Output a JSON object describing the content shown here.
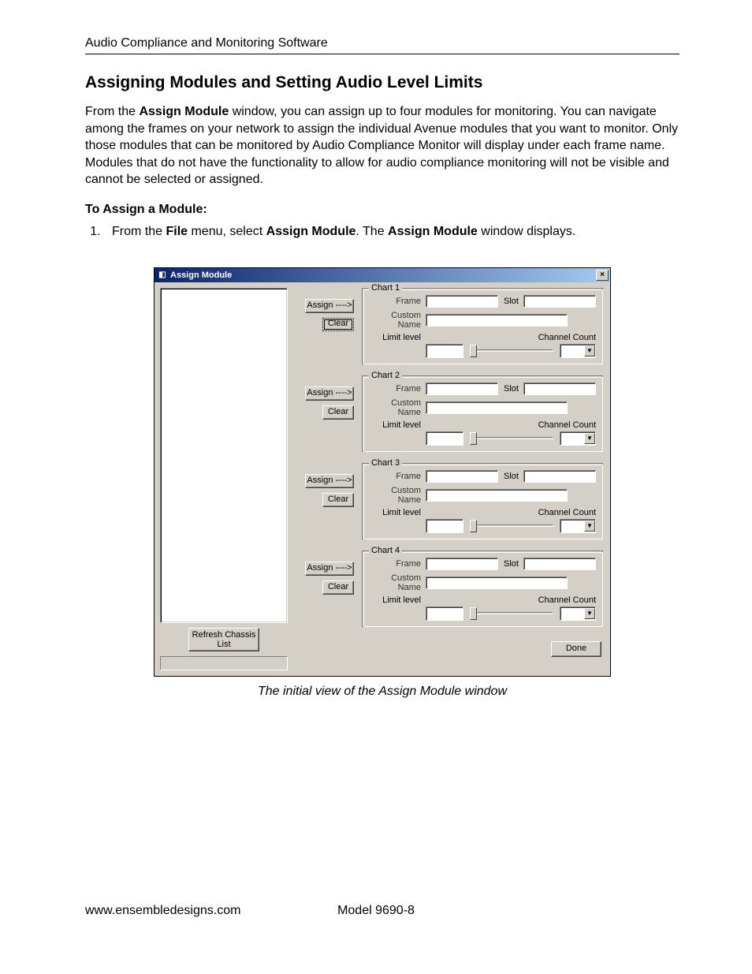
{
  "header": {
    "running_head": "Audio Compliance and Monitoring Software"
  },
  "heading": "Assigning Modules and Setting Audio Level Limits",
  "para1_pre": "From the ",
  "para1_b1": "Assign Module",
  "para1_post": " window, you can assign up to four modules for monitoring. You can navigate among the frames on your network to assign the individual Avenue modules that you want to monitor. Only those modules that can be monitored by Audio Compliance Monitor will display under each frame name. Modules that do not have the functionality to allow for audio compliance monitoring will not be visible and cannot be selected or assigned.",
  "subheading": "To Assign a Module:",
  "step1_pre": "From the ",
  "step1_b1": "File",
  "step1_mid1": " menu, select ",
  "step1_b2": "Assign Module",
  "step1_mid2": ". The ",
  "step1_b3": "Assign Module",
  "step1_post": " window displays.",
  "caption": "The initial view of the Assign Module window",
  "footer": {
    "url": "www.ensembledesigns.com",
    "model": "Model 9690-8"
  },
  "win": {
    "title": "Assign Module",
    "close_x": "×",
    "assign_btn": "Assign ---->",
    "clear_btn": "Clear",
    "refresh_btn": "Refresh Chassis List",
    "chart_prefix": "Chart",
    "lbls": {
      "frame": "Frame",
      "slot": "Slot",
      "custom": "Custom Name",
      "limit": "Limit level",
      "cc": "Channel Count"
    },
    "done": "Done",
    "charts": [
      1,
      2,
      3,
      4
    ]
  }
}
